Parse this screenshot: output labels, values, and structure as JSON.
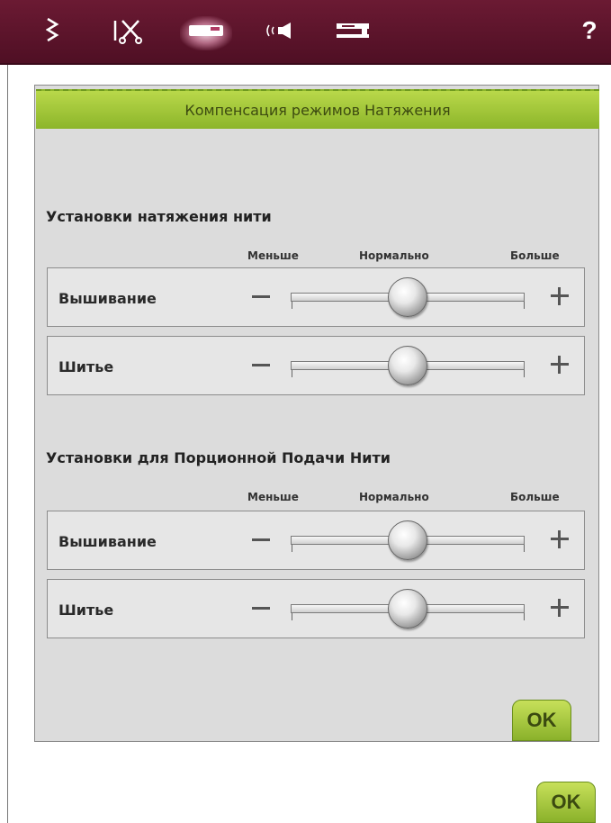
{
  "toolbar": {
    "icons": [
      "stitch-icon",
      "scissors-icon",
      "sewing-machine-tab-icon",
      "sound-icon",
      "machine-icon"
    ],
    "help_label": "?"
  },
  "dialog": {
    "title": "Компенсация режимов Натяжения",
    "ok_label": "OK",
    "sections": [
      {
        "title": "Установки натяжения нити",
        "scale": {
          "less": "Меньше",
          "normal": "Нормально",
          "more": "Больше"
        },
        "rows": [
          {
            "label": "Вышивание",
            "value": 0.5
          },
          {
            "label": "Шитье",
            "value": 0.5
          }
        ]
      },
      {
        "title": "Установки для Порционной Подачи Нити",
        "scale": {
          "less": "Меньше",
          "normal": "Нормально",
          "more": "Больше"
        },
        "rows": [
          {
            "label": "Вышивание",
            "value": 0.5
          },
          {
            "label": "Шитье",
            "value": 0.5
          }
        ]
      }
    ]
  },
  "page": {
    "ok_label": "OK"
  }
}
